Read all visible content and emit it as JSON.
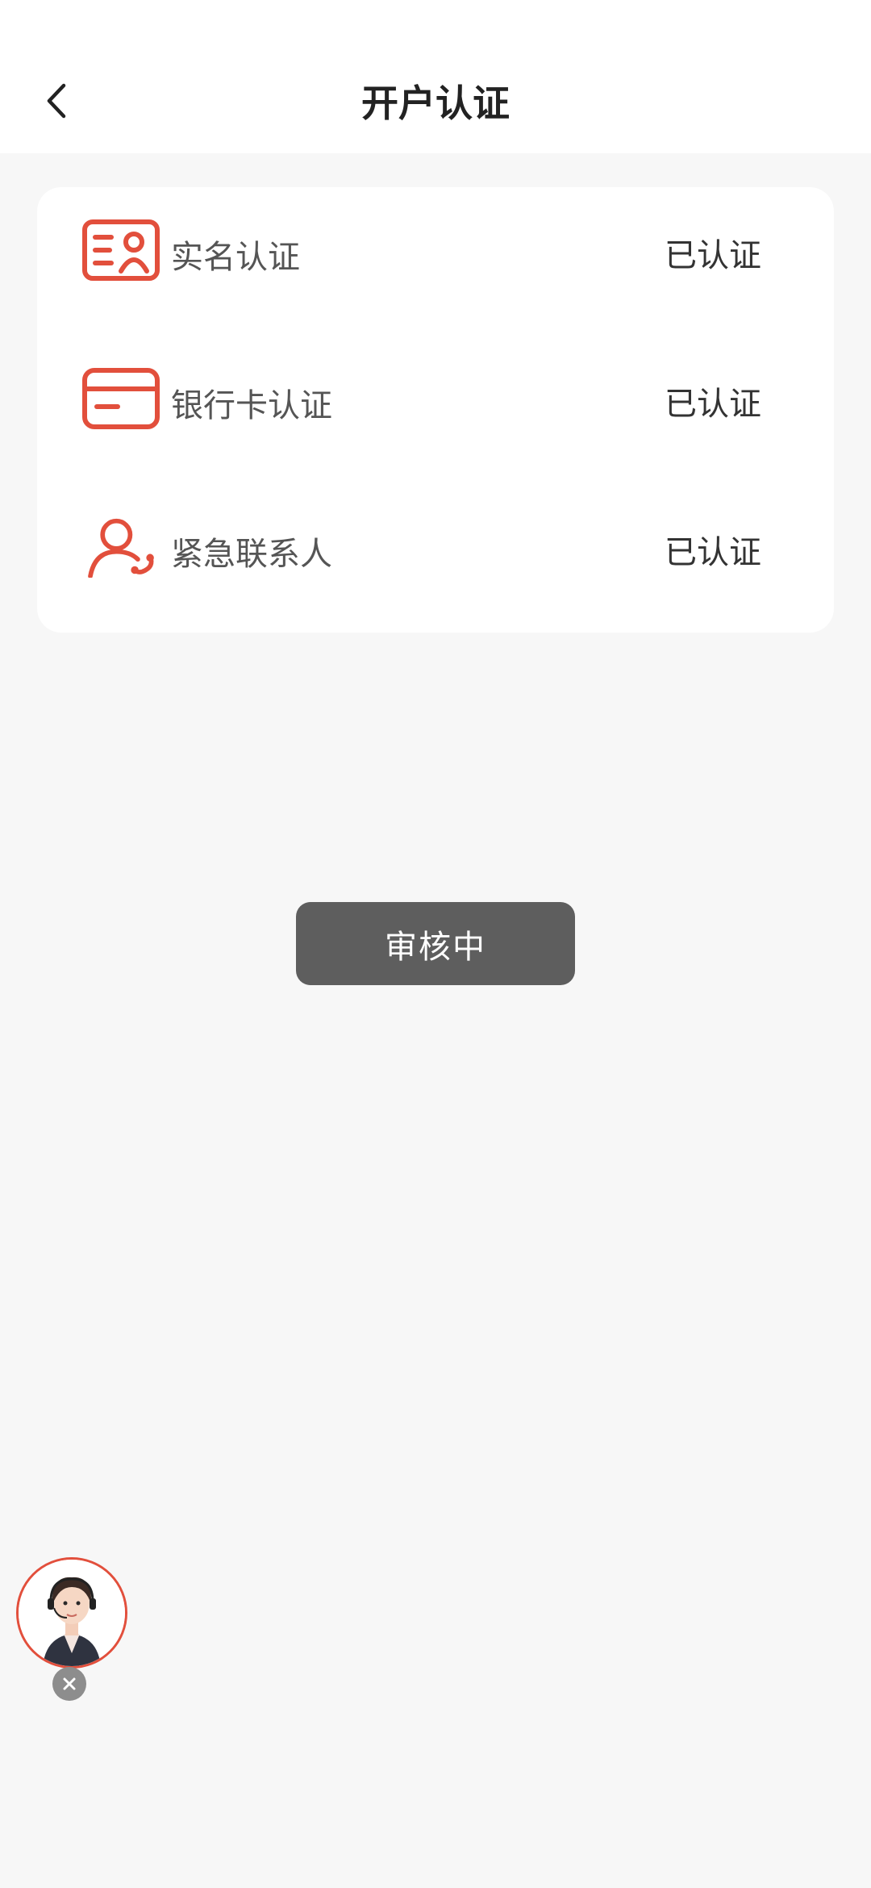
{
  "header": {
    "title": "开户认证",
    "back_icon": "chevron-left-icon"
  },
  "verification": {
    "items": [
      {
        "label": "实名认证",
        "status": "已认证",
        "icon": "id-card-icon"
      },
      {
        "label": "银行卡认证",
        "status": "已认证",
        "icon": "bank-card-icon"
      },
      {
        "label": "紧急联系人",
        "status": "已认证",
        "icon": "contact-phone-icon"
      }
    ]
  },
  "review_button": {
    "label": "审核中"
  },
  "support_widget": {
    "avatar": "customer-service-avatar",
    "close_icon": "close-icon"
  },
  "colors": {
    "accent": "#e24f3c",
    "background": "#f7f7f7",
    "card": "#ffffff",
    "button": "#5e5e5e"
  }
}
